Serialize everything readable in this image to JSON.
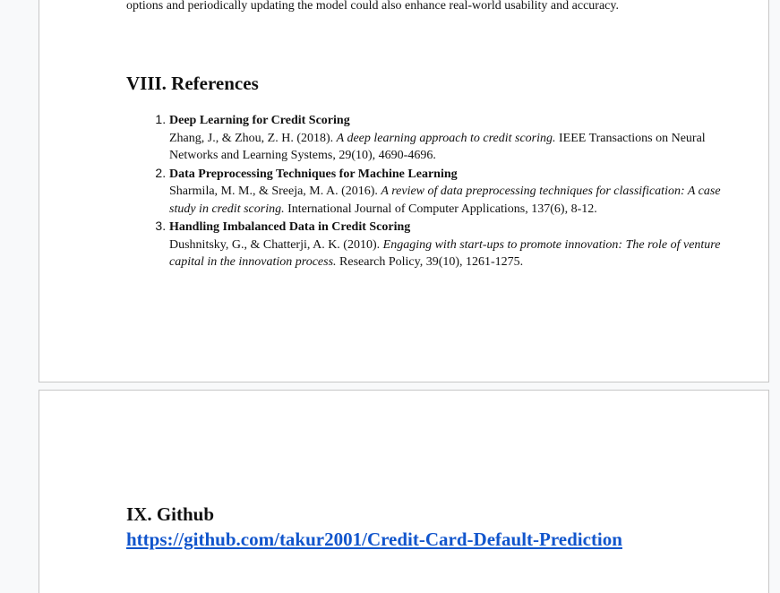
{
  "section_intro": {
    "text": "options and periodically updating the model could also enhance real-world usability and accuracy."
  },
  "references": {
    "heading": "VIII. References",
    "items": [
      {
        "title": "Deep Learning for Credit Scoring",
        "authors": "Zhang, J., & Zhou, Z. H. (2018). ",
        "work": "A deep learning approach to credit scoring.",
        "venue": " IEEE Transactions on Neural Networks and Learning Systems, 29(10), 4690-4696."
      },
      {
        "title": "Data Preprocessing Techniques for Machine Learning",
        "authors": "Sharmila, M. M., & Sreeja, M. A. (2016). ",
        "work": "A review of data preprocessing techniques for classification: A case study in credit scoring.",
        "venue": " International Journal of Computer Applications, 137(6), 8-12."
      },
      {
        "title": "Handling Imbalanced Data in Credit Scoring",
        "authors": "Dushnitsky, G., & Chatterji, A. K. (2010). ",
        "work": "Engaging with start-ups to promote innovation: The role of venture capital in the innovation process.",
        "venue": " Research Policy, 39(10), 1261-1275."
      }
    ]
  },
  "github": {
    "heading": "IX. Github",
    "link_text": "https://github.com/takur2001/Credit-Card-Default-Prediction",
    "link_href": "https://github.com/takur2001/Credit-Card-Default-Prediction"
  },
  "colors": {
    "link": "#1155cc",
    "page_background": "#ffffff",
    "canvas_background": "#f8f9fa"
  }
}
